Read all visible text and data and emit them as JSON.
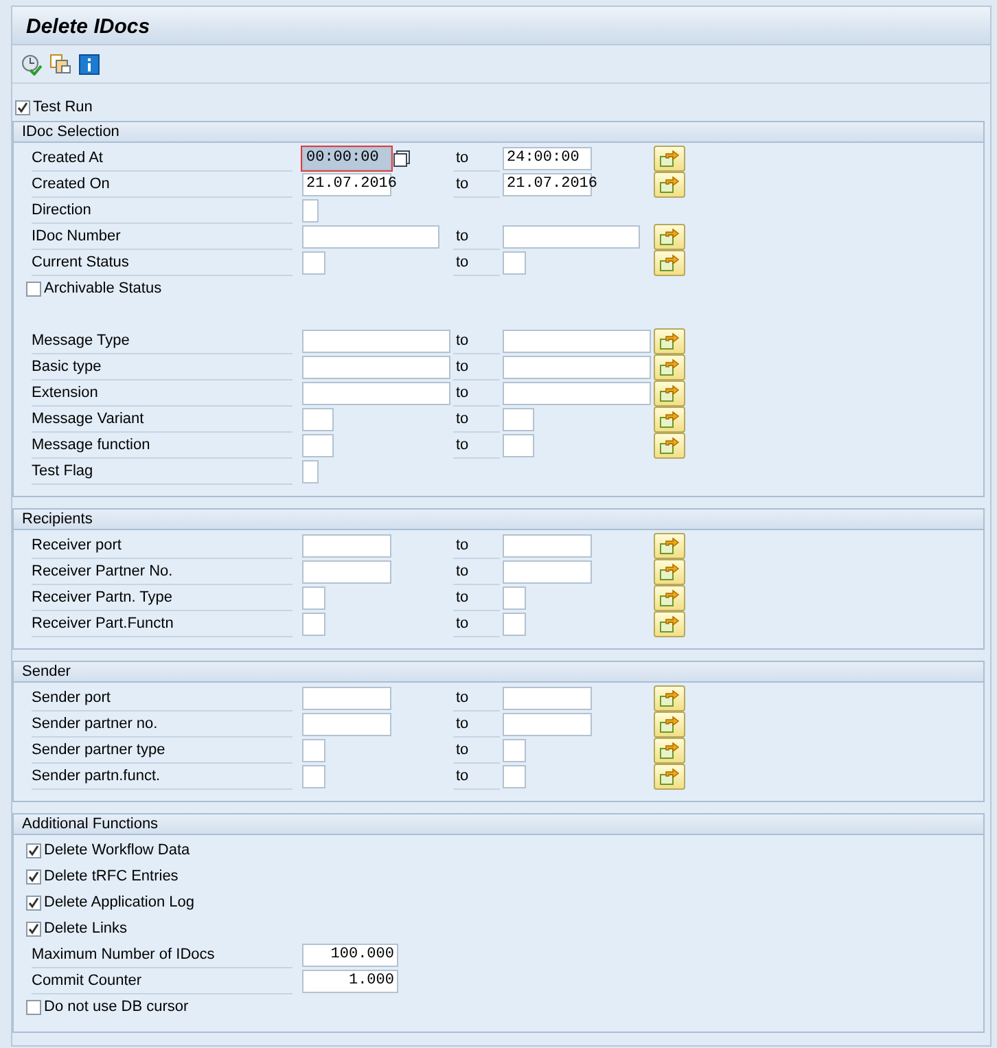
{
  "window": {
    "title": "Delete IDocs"
  },
  "toolbar": [
    {
      "kind": "execute"
    },
    {
      "kind": "variants"
    },
    {
      "kind": "info"
    }
  ],
  "test_run": {
    "label": "Test Run",
    "checked": true
  },
  "sections": [
    {
      "title": "IDoc Selection",
      "rows": [
        {
          "kind": "range",
          "label": "Created At",
          "low": {
            "value": "00:00:00",
            "kind": "date",
            "focused": true
          },
          "high": {
            "value": "24:00:00",
            "kind": "date"
          },
          "to": "to"
        },
        {
          "kind": "range",
          "label": "Created On",
          "low": {
            "value": "21.07.2016",
            "kind": "date"
          },
          "high": {
            "value": "21.07.2016",
            "kind": "date"
          },
          "to": "to"
        },
        {
          "kind": "single",
          "label": "Direction",
          "low": {
            "kind": "tiny"
          }
        },
        {
          "kind": "range",
          "label": "IDoc Number",
          "low": {
            "kind": "long"
          },
          "high": {
            "kind": "long"
          },
          "to": "to"
        },
        {
          "kind": "range",
          "label": "Current Status",
          "low": {
            "kind": "small"
          },
          "high": {
            "kind": "small"
          },
          "to": "to"
        },
        {
          "kind": "check",
          "label": "Archivable Status",
          "checked": false
        },
        {
          "kind": "range",
          "label": "Message Type",
          "spaced": true,
          "low": {
            "kind": "wide"
          },
          "high": {
            "kind": "wide"
          },
          "to": "to"
        },
        {
          "kind": "range",
          "label": "Basic type",
          "low": {
            "kind": "wide"
          },
          "high": {
            "kind": "wide"
          },
          "to": "to"
        },
        {
          "kind": "range",
          "label": "Extension",
          "low": {
            "kind": "wide"
          },
          "high": {
            "kind": "wide"
          },
          "to": "to"
        },
        {
          "kind": "range",
          "label": "Message Variant",
          "low": {
            "kind": "medium"
          },
          "high": {
            "kind": "medium"
          },
          "to": "to"
        },
        {
          "kind": "range",
          "label": "Message function",
          "low": {
            "kind": "medium"
          },
          "high": {
            "kind": "medium"
          },
          "to": "to"
        },
        {
          "kind": "single",
          "label": "Test Flag",
          "low": {
            "kind": "tiny"
          }
        }
      ]
    },
    {
      "title": "Recipients",
      "rows": [
        {
          "kind": "range",
          "label": "Receiver port",
          "low": {
            "kind": "date"
          },
          "high": {
            "kind": "date"
          },
          "to": "to"
        },
        {
          "kind": "range",
          "label": "Receiver Partner No.",
          "low": {
            "kind": "date"
          },
          "high": {
            "kind": "date"
          },
          "to": "to"
        },
        {
          "kind": "range",
          "label": "Receiver Partn. Type",
          "low": {
            "kind": "small"
          },
          "high": {
            "kind": "small"
          },
          "to": "to"
        },
        {
          "kind": "range",
          "label": "Receiver Part.Functn",
          "low": {
            "kind": "small"
          },
          "high": {
            "kind": "small"
          },
          "to": "to"
        }
      ]
    },
    {
      "title": "Sender",
      "rows": [
        {
          "kind": "range",
          "label": "Sender port",
          "low": {
            "kind": "date"
          },
          "high": {
            "kind": "date"
          },
          "to": "to"
        },
        {
          "kind": "range",
          "label": "Sender partner no.",
          "low": {
            "kind": "date"
          },
          "high": {
            "kind": "date"
          },
          "to": "to"
        },
        {
          "kind": "range",
          "label": "Sender partner type",
          "low": {
            "kind": "small"
          },
          "high": {
            "kind": "small"
          },
          "to": "to"
        },
        {
          "kind": "range",
          "label": "Sender partn.funct.",
          "low": {
            "kind": "small"
          },
          "high": {
            "kind": "small"
          },
          "to": "to"
        }
      ]
    },
    {
      "title": "Additional Functions",
      "rows": [
        {
          "kind": "check",
          "label": "Delete Workflow Data",
          "checked": true
        },
        {
          "kind": "check",
          "label": "Delete tRFC Entries",
          "checked": true
        },
        {
          "kind": "check",
          "label": "Delete Application Log",
          "checked": true
        },
        {
          "kind": "check",
          "label": "Delete Links",
          "checked": true
        },
        {
          "kind": "single",
          "label": "Maximum Number of IDocs",
          "low": {
            "value": "100.000",
            "kind": "number"
          }
        },
        {
          "kind": "single",
          "label": "Commit Counter",
          "low": {
            "value": "1.000",
            "kind": "number"
          }
        },
        {
          "kind": "check",
          "label": "Do not use DB cursor",
          "checked": false
        }
      ]
    }
  ]
}
